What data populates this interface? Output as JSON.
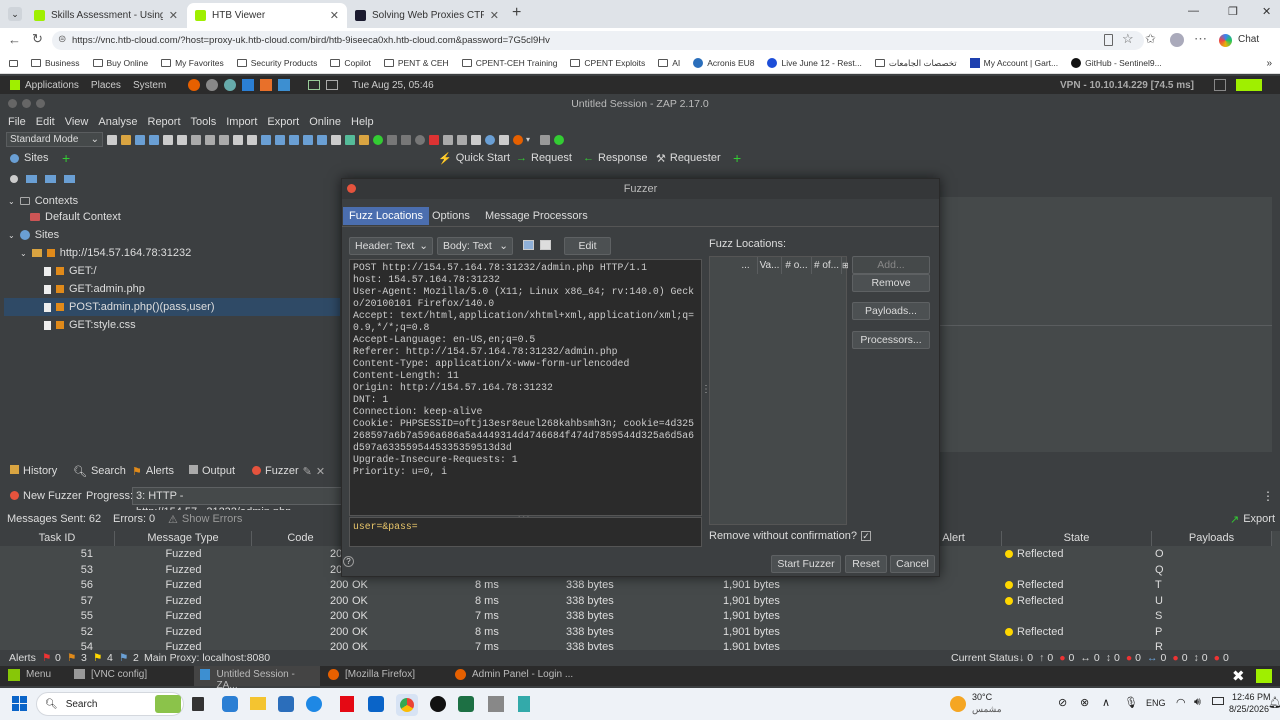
{
  "browser": {
    "tabs": [
      {
        "label": "Skills Assessment - Using Web Pro",
        "favicon_color": "#9fef00"
      },
      {
        "label": "HTB Viewer",
        "favicon_color": "#9fef00"
      },
      {
        "label": "Solving Web Proxies CTF Challeng",
        "favicon_color": "#1a1a2e"
      }
    ],
    "url": "https://vnc.htb-cloud.com/?host=proxy-uk.htb-cloud.com/bird/htb-9iseeca0xh.htb-cloud.com&password=7G5cl9Hv",
    "chat_label": "Chat",
    "bookmarks": [
      "Business",
      "Buy Online",
      "My Favorites",
      "Security Products",
      "Copilot",
      "PENT & CEH",
      "CPENT-CEH Training",
      "CPENT Exploits",
      "AI",
      "Acronis EU8",
      "Live June 12 - Rest...",
      "تخصصات الجامعات",
      "My Account | Gart...",
      "GitHub - Sentinel9..."
    ]
  },
  "gnome": {
    "applications": "Applications",
    "places": "Places",
    "system": "System",
    "clock": "Tue Aug 25, 05:46",
    "vpn": "VPN - 10.10.14.229 [74.5 ms]"
  },
  "zap": {
    "title": "Untitled Session - ZAP 2.17.0",
    "menu": [
      "File",
      "Edit",
      "View",
      "Analyse",
      "Report",
      "Tools",
      "Import",
      "Export",
      "Online",
      "Help"
    ],
    "mode": "Standard Mode",
    "sites_tab": "Sites",
    "work_tabs": [
      "Quick Start",
      "Request",
      "Response",
      "Requester"
    ],
    "tree": {
      "contexts": "Contexts",
      "default_context": "Default Context",
      "sites": "Sites",
      "host": "http://154.57.164.78:31232",
      "nodes": [
        "GET:/",
        "GET:admin.php",
        "POST:admin.php()(pass,user)",
        "GET:style.css"
      ]
    },
    "bottom_tabs": [
      "History",
      "Search",
      "Alerts",
      "Output",
      "Fuzzer"
    ],
    "new_fuzzer": "New Fuzzer",
    "progress_label": "Progress:",
    "progress_value": "3: HTTP - http://154.57...31232/admin.php",
    "messages_sent": "Messages Sent: 62",
    "errors": "Errors: 0",
    "show_errors": "Show Errors",
    "export": "Export",
    "columns": [
      "Task ID",
      "Message Type",
      "Code",
      "Alert",
      "State",
      "Payloads"
    ],
    "rows": [
      {
        "id": "51",
        "type": "Fuzzed",
        "code": "20",
        "reason": "",
        "rtt": "",
        "hsize": "",
        "bsize": "",
        "state": "Reflected",
        "payload": "O"
      },
      {
        "id": "53",
        "type": "Fuzzed",
        "code": "20",
        "reason": "",
        "rtt": "",
        "hsize": "",
        "bsize": "",
        "state": "",
        "payload": "Q"
      },
      {
        "id": "56",
        "type": "Fuzzed",
        "code": "200",
        "reason": "OK",
        "rtt": "8 ms",
        "hsize": "338 bytes",
        "bsize": "1,901 bytes",
        "state": "Reflected",
        "payload": "T"
      },
      {
        "id": "57",
        "type": "Fuzzed",
        "code": "200",
        "reason": "OK",
        "rtt": "8 ms",
        "hsize": "338 bytes",
        "bsize": "1,901 bytes",
        "state": "Reflected",
        "payload": "U"
      },
      {
        "id": "55",
        "type": "Fuzzed",
        "code": "200",
        "reason": "OK",
        "rtt": "7 ms",
        "hsize": "338 bytes",
        "bsize": "1,901 bytes",
        "state": "",
        "payload": "S"
      },
      {
        "id": "52",
        "type": "Fuzzed",
        "code": "200",
        "reason": "OK",
        "rtt": "8 ms",
        "hsize": "338 bytes",
        "bsize": "1,901 bytes",
        "state": "Reflected",
        "payload": "P"
      },
      {
        "id": "54",
        "type": "Fuzzed",
        "code": "200",
        "reason": "OK",
        "rtt": "7 ms",
        "hsize": "338 bytes",
        "bsize": "1,901 bytes",
        "state": "",
        "payload": "R"
      }
    ],
    "status": {
      "alerts_label": "Alerts",
      "alert_counts": [
        "0",
        "3",
        "4",
        "2"
      ],
      "proxy": "Main Proxy: localhost:8080",
      "current_status": "Current Status",
      "status_counts": [
        "0",
        "0",
        "0",
        "0",
        "0",
        "0",
        "0",
        "0",
        "0",
        "0"
      ]
    }
  },
  "fuzzer": {
    "title": "Fuzzer",
    "tabs": [
      "Fuzz Locations",
      "Options",
      "Message Processors"
    ],
    "header_select": "Header: Text",
    "body_select": "Body: Text",
    "edit_button": "Edit",
    "request_text": "POST http://154.57.164.78:31232/admin.php HTTP/1.1\nhost: 154.57.164.78:31232\nUser-Agent: Mozilla/5.0 (X11; Linux x86_64; rv:140.0) Gecko/20100101 Firefox/140.0\nAccept: text/html,application/xhtml+xml,application/xml;q=0.9,*/*;q=0.8\nAccept-Language: en-US,en;q=0.5\nReferer: http://154.57.164.78:31232/admin.php\nContent-Type: application/x-www-form-urlencoded\nContent-Length: 11\nOrigin: http://154.57.164.78:31232\nDNT: 1\nConnection: keep-alive\nCookie: PHPSESSID=oftj13esr8euel268kahbsmh3n; cookie=4d325268597a6b7a596a686a5a4449314d4746684f474d7859544d325a6d5a6d597a6335595445335359513d3d\nUpgrade-Insecure-Requests: 1\nPriority: u=0, i",
    "body_text": "user=&pass=",
    "locations_label": "Fuzz Locations:",
    "loc_columns": [
      "...",
      "Va...",
      "# o...",
      "# of..."
    ],
    "add_button": "Add...",
    "remove_button": "Remove",
    "payloads_button": "Payloads...",
    "processors_button": "Processors...",
    "remove_confirm": "Remove without confirmation?",
    "start_button": "Start Fuzzer",
    "reset_button": "Reset",
    "cancel_button": "Cancel"
  },
  "taskbar_top": {
    "menu": "Menu",
    "items": [
      "[VNC config]",
      "Untitled Session - ZA...",
      "[Mozilla Firefox]",
      "Admin Panel - Login ..."
    ]
  },
  "windows": {
    "search": "Search",
    "weather_temp": "30°C",
    "weather_desc": "مشمس",
    "lang": "ENG",
    "time": "12:46 PM",
    "date": "8/25/2026"
  },
  "colors": {
    "accent": "#4b6eaf",
    "reflected": "#ffd700",
    "htb_green": "#9fef00",
    "chrome_bg": "#dfe3e8"
  }
}
